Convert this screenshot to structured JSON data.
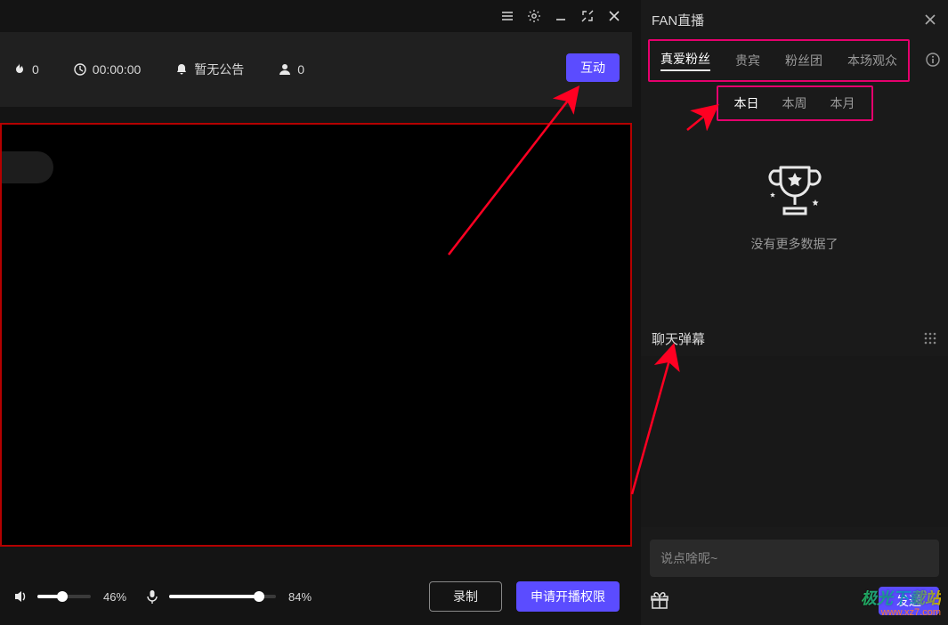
{
  "titlebar": {
    "icons": [
      "menu-icon",
      "gear-icon",
      "minimize-icon",
      "maximize-icon",
      "close-icon"
    ]
  },
  "stats": {
    "fire_count": "0",
    "timer": "00:00:00",
    "announcement": "暂无公告",
    "viewers": "0"
  },
  "interact_button": "互动",
  "bottom": {
    "vol_pct": "46%",
    "mic_pct": "84%",
    "record_label": "录制",
    "apply_label": "申请开播权限"
  },
  "panel": {
    "title": "FAN直播",
    "tabs": [
      "真爱粉丝",
      "贵宾",
      "粉丝团",
      "本场观众"
    ],
    "active_tab_index": 0,
    "time_tabs": [
      "本日",
      "本周",
      "本月"
    ],
    "active_time_index": 0,
    "empty_text": "没有更多数据了",
    "chat_title": "聊天弹幕",
    "chat_placeholder": "说点啥呢~",
    "send_label": "发送"
  },
  "watermark": {
    "line1": "极光下载站",
    "line2": "www.xz7.com"
  }
}
